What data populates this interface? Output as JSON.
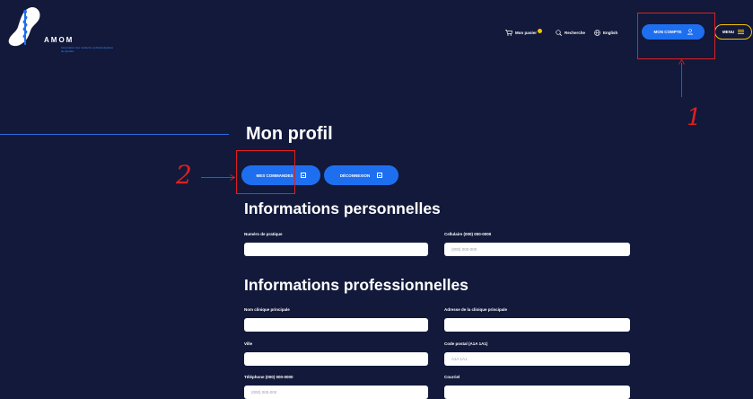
{
  "header": {
    "logo": {
      "wordmark": "AMOM",
      "subtitle": "Association des médecins ophtalmologistes du Québec"
    },
    "nav": {
      "cart_label": "Mon panier",
      "search_label": "Recherche",
      "language_label": "English"
    },
    "account_button_label": "MON COMPTE",
    "menu_button_label": "MENU"
  },
  "main": {
    "title": "Mon profil",
    "actions": {
      "orders_label": "MES COMMANDES",
      "logout_label": "DÉCONNEXION"
    },
    "personal": {
      "title": "Informations personnelles",
      "practice_number_label": "Numéro de pratique",
      "practice_number_value": "",
      "cell_label": "Cellulaire (000) 000-0000",
      "cell_placeholder": "(000) 000-000"
    },
    "professional": {
      "title": "Informations professionnelles",
      "clinic_name_label": "Nom clinique principale",
      "clinic_name_value": "",
      "clinic_address_label": "Adresse de la clinique principale",
      "clinic_address_value": "",
      "city_label": "Ville",
      "city_value": "",
      "postal_code_label": "Code postal (A1A 1A1)",
      "postal_code_placeholder": "A1A 1A1",
      "phone_label": "Téléphone (000) 000-0000",
      "phone_placeholder": "(000) 000-000",
      "email_label": "Courriel",
      "email_value": ""
    }
  },
  "annotations": {
    "marker_1": "1",
    "marker_2": "2"
  },
  "colors": {
    "background": "#12193a",
    "primary_blue": "#1e6ff0",
    "accent_yellow": "#f6c400",
    "annotation_red": "#e02020"
  }
}
